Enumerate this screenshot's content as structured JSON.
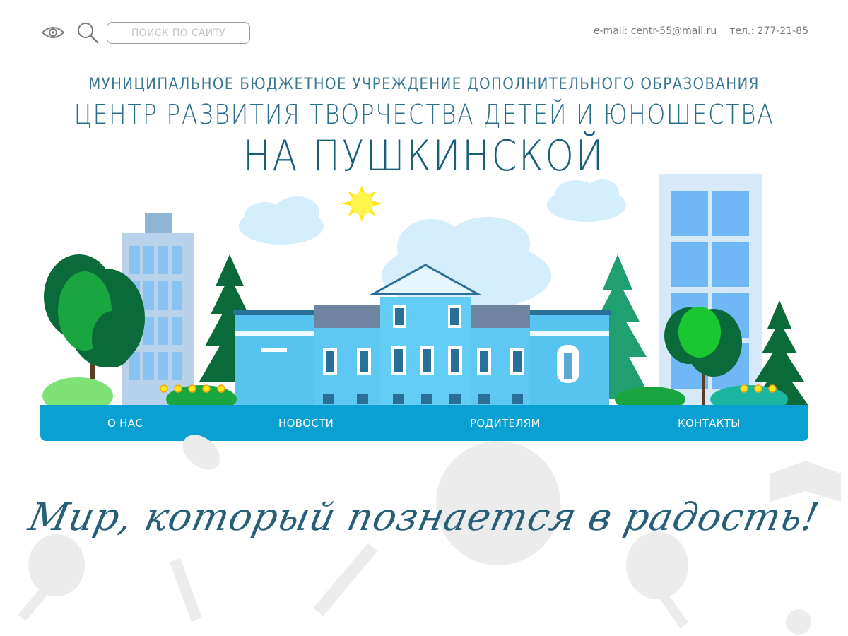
{
  "header": {
    "search_placeholder": "ПОИСК ПО САЙТУ",
    "email": "e-mail: centr-55@mail.ru",
    "phone": "тел.: 277-21-85",
    "icons": [
      "eye-icon",
      "search-icon"
    ]
  },
  "titles": {
    "subtitle": "МУНИЦИПАЛЬНОЕ БЮДЖЕТНОЕ УЧРЕЖДЕНИЕ ДОПОЛНИТЕЛЬНОГО ОБРАЗОВАНИЯ",
    "main": "ЦЕНТР РАЗВИТИЯ ТВОРЧЕСТВА ДЕТЕЙ И ЮНОШЕСТВА",
    "accent": "НА ПУШКИНСКОЙ"
  },
  "nav": {
    "items": [
      {
        "label": "О НАС"
      },
      {
        "label": "НОВОСТИ"
      },
      {
        "label": "РОДИТЕЛЯМ"
      },
      {
        "label": "КОНТАКТЫ"
      }
    ]
  },
  "slogan": "Мир, который познается в радость!",
  "colors": {
    "accent": "#0aa0d2",
    "title": "#1a5e7c",
    "building": "#5bc8f2",
    "tree_dark": "#0b6a3a",
    "tree_light": "#19a640"
  }
}
